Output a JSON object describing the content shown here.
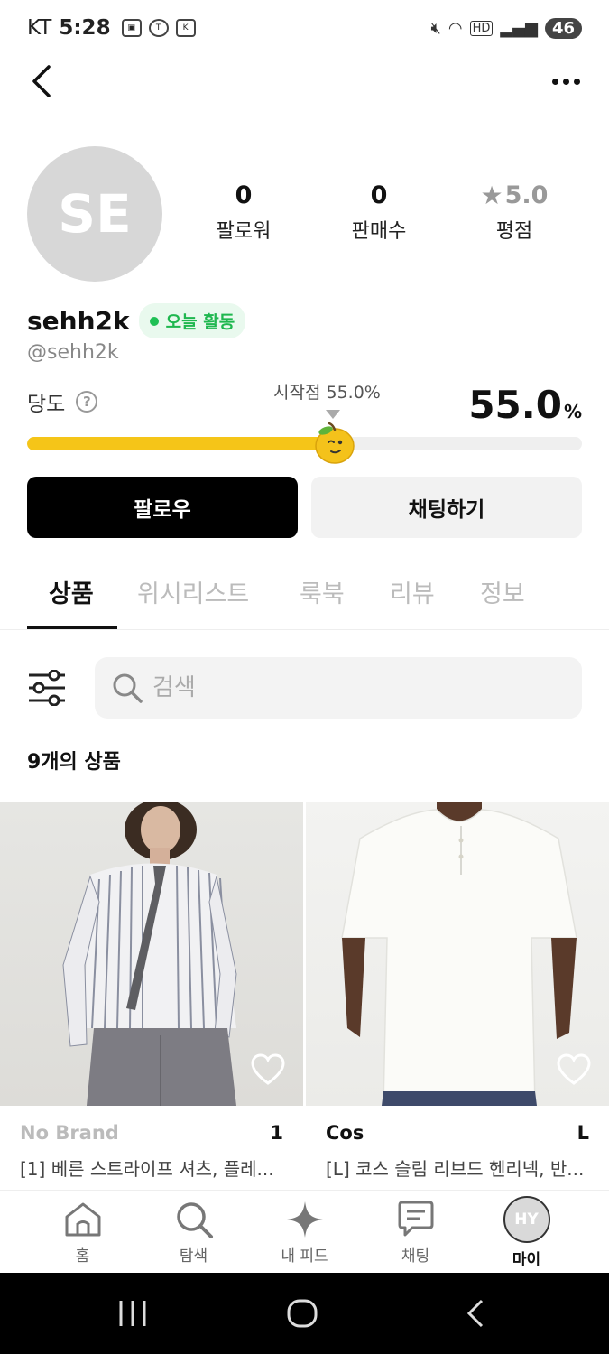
{
  "status_bar": {
    "carrier": "KT",
    "time": "5:28",
    "network": "HD",
    "battery": "46"
  },
  "profile": {
    "avatar_initials": "SE",
    "stats": [
      {
        "value": "0",
        "label": "팔로워"
      },
      {
        "value": "0",
        "label": "판매수"
      },
      {
        "value": "5.0",
        "label": "평점"
      }
    ],
    "username": "sehh2k",
    "activity_badge": "오늘 활동",
    "handle": "@sehh2k",
    "dangdo_label": "당도",
    "start_point_label": "시작점 55.0%",
    "percent_value": "55.0",
    "percent_unit": "%",
    "sweetness_fraction": 0.55
  },
  "actions": {
    "follow_label": "팔로우",
    "chat_label": "채팅하기"
  },
  "tabs": [
    "상품",
    "위시리스트",
    "룩북",
    "리뷰",
    "정보"
  ],
  "search": {
    "placeholder": "검색"
  },
  "product_count": "9개의 상품",
  "products": [
    {
      "brand": "No Brand",
      "size": "1",
      "title": "[1] 베른 스트라이프 셔츠, 플레..."
    },
    {
      "brand": "Cos",
      "size": "L",
      "title": "[L] 코스 슬림 리브드 헨리넥, 반..."
    }
  ],
  "bottom_nav": [
    {
      "label": "홈",
      "icon": "home-icon"
    },
    {
      "label": "탐색",
      "icon": "search-icon"
    },
    {
      "label": "내 피드",
      "icon": "sparkle-icon"
    },
    {
      "label": "채팅",
      "icon": "chat-icon"
    },
    {
      "label": "마이",
      "icon": "avatar"
    }
  ],
  "my_avatar_initials": "HY",
  "colors": {
    "accent_yellow": "#f5c518",
    "active_green": "#1fb74f",
    "follow_button": "#000000"
  }
}
